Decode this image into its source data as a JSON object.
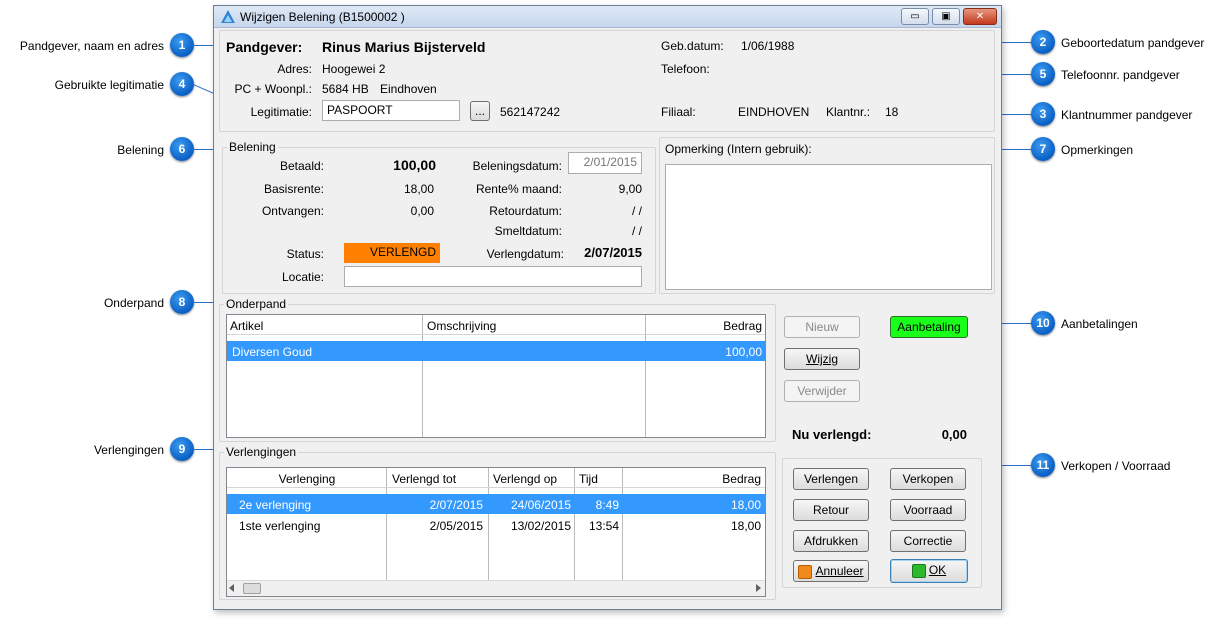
{
  "window": {
    "title": "Wijzigen Belening  (B1500002  )",
    "min": "▭",
    "max": "▣",
    "close": "✕"
  },
  "annotations": [
    {
      "num": "1",
      "label": "Pandgever, naam en adres"
    },
    {
      "num": "2",
      "label": "Geboortedatum pandgever"
    },
    {
      "num": "3",
      "label": "Klantnummer pandgever"
    },
    {
      "num": "4",
      "label": "Gebruikte legitimatie"
    },
    {
      "num": "5",
      "label": "Telefoonnr. pandgever"
    },
    {
      "num": "6",
      "label": "Belening"
    },
    {
      "num": "7",
      "label": "Opmerkingen"
    },
    {
      "num": "8",
      "label": "Onderpand"
    },
    {
      "num": "9",
      "label": "Verlengingen"
    },
    {
      "num": "10",
      "label": "Aanbetalingen"
    },
    {
      "num": "11",
      "label": "Verkopen / Voorraad"
    }
  ],
  "pandgever": {
    "label": "Pandgever:",
    "name": "Rinus Marius Bijsterveld",
    "adres_label": "Adres:",
    "adres": "Hoogewei 2",
    "pc_label": "PC + Woonpl.:",
    "postcode": "5684 HB",
    "woonplaats": "Eindhoven",
    "legit_label": "Legitimatie:",
    "legitimatie": "PASPOORT",
    "legit_btn": "...",
    "legit_nr": "562147242",
    "geb_label": "Geb.datum:",
    "geb": "1/06/1988",
    "tel_label": "Telefoon:",
    "tel": "",
    "filiaal_label": "Filiaal:",
    "filiaal": "EINDHOVEN",
    "klantnr_label": "Klantnr.:",
    "klantnr": "18"
  },
  "belening": {
    "title": "Belening",
    "betaald_label": "Betaald:",
    "betaald": "100,00",
    "basisrente_label": "Basisrente:",
    "basisrente": "18,00",
    "ontvangen_label": "Ontvangen:",
    "ontvangen": "0,00",
    "status_label": "Status:",
    "status": "VERLENGD",
    "locatie_label": "Locatie:",
    "locatie": "",
    "beleningsdatum_label": "Beleningsdatum:",
    "beleningsdatum": "2/01/2015",
    "rente_label": "Rente% maand:",
    "rente": "9,00",
    "retour_label": "Retourdatum:",
    "retour": "/ /",
    "smelt_label": "Smeltdatum:",
    "smelt": "/ /",
    "verlengdatum_label": "Verlengdatum:",
    "verlengdatum": "2/07/2015"
  },
  "opmerking": {
    "title": "Opmerking (Intern gebruik):",
    "text": ""
  },
  "onderpand": {
    "title": "Onderpand",
    "headers": [
      "Artikel",
      "Omschrijving",
      "Bedrag"
    ],
    "rows": [
      {
        "artikel": "Diversen Goud",
        "omschrijving": "",
        "bedrag": "100,00"
      }
    ]
  },
  "onderpand_buttons": {
    "nieuw": "Nieuw",
    "wijzig": "Wijzig",
    "verwijder": "Verwijder",
    "aanbetaling": "Aanbetaling"
  },
  "nu_verlengd": {
    "label": "Nu verlengd:",
    "value": "0,00"
  },
  "verlengingen": {
    "title": "Verlengingen",
    "headers": [
      "Verlenging",
      "Verlengd tot",
      "Verlengd op",
      "Tijd",
      "Bedrag"
    ],
    "rows": [
      {
        "verlenging": "2e verlenging",
        "tot": "2/07/2015",
        "op": "24/06/2015",
        "tijd": "8:49",
        "bedrag": "18,00"
      },
      {
        "verlenging": "1ste verlenging",
        "tot": "2/05/2015",
        "op": "13/02/2015",
        "tijd": "13:54",
        "bedrag": "18,00"
      }
    ]
  },
  "actions": {
    "verlengen": "Verlengen",
    "verkopen": "Verkopen",
    "retour": "Retour",
    "voorraad": "Voorraad",
    "afdrukken": "Afdrukken",
    "correctie": "Correctie",
    "annuleer": "Annuleer",
    "ok": "OK"
  },
  "colors": {
    "selection": "#3399ff",
    "status": "#ff8000",
    "aanbetaling": "#19ff19",
    "badge": "#0a5fc4"
  }
}
